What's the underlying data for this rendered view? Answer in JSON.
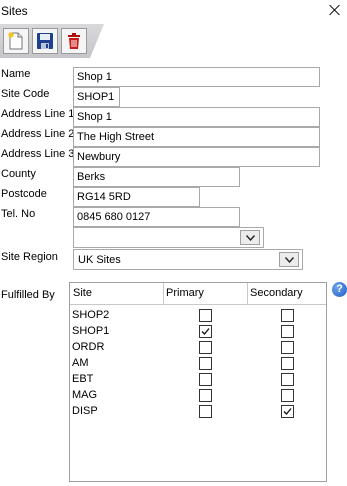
{
  "window": {
    "title": "Sites"
  },
  "toolbar": {
    "new_icon": "new-document-icon",
    "save_icon": "save-icon",
    "delete_icon": "delete-icon"
  },
  "form": {
    "name": {
      "label": "Name",
      "value": "Shop 1"
    },
    "site_code": {
      "label": "Site Code",
      "value": "SHOP1"
    },
    "address1": {
      "label": "Address Line 1",
      "value": "Shop 1"
    },
    "address2": {
      "label": "Address Line 2",
      "value": "The High Street"
    },
    "address3": {
      "label": "Address Line 3",
      "value": "Newbury"
    },
    "county": {
      "label": "County",
      "value": "Berks"
    },
    "postcode": {
      "label": "Postcode",
      "value": "RG14 5RD"
    },
    "tel": {
      "label": "Tel. No",
      "value": "0845 680 0127"
    },
    "extra_combo": {
      "value": ""
    },
    "site_region": {
      "label": "Site Region",
      "value": "UK Sites"
    }
  },
  "fulfilled": {
    "label": "Fulfilled By",
    "columns": [
      "Site",
      "Primary",
      "Secondary"
    ],
    "rows": [
      {
        "site": "SHOP2",
        "primary": false,
        "secondary": false
      },
      {
        "site": "SHOP1",
        "primary": true,
        "secondary": false
      },
      {
        "site": "ORDR",
        "primary": false,
        "secondary": false
      },
      {
        "site": "AM",
        "primary": false,
        "secondary": false
      },
      {
        "site": "EBT",
        "primary": false,
        "secondary": false
      },
      {
        "site": "MAG",
        "primary": false,
        "secondary": false
      },
      {
        "site": "DISP",
        "primary": false,
        "secondary": true
      }
    ]
  },
  "help": {
    "glyph": "?"
  }
}
